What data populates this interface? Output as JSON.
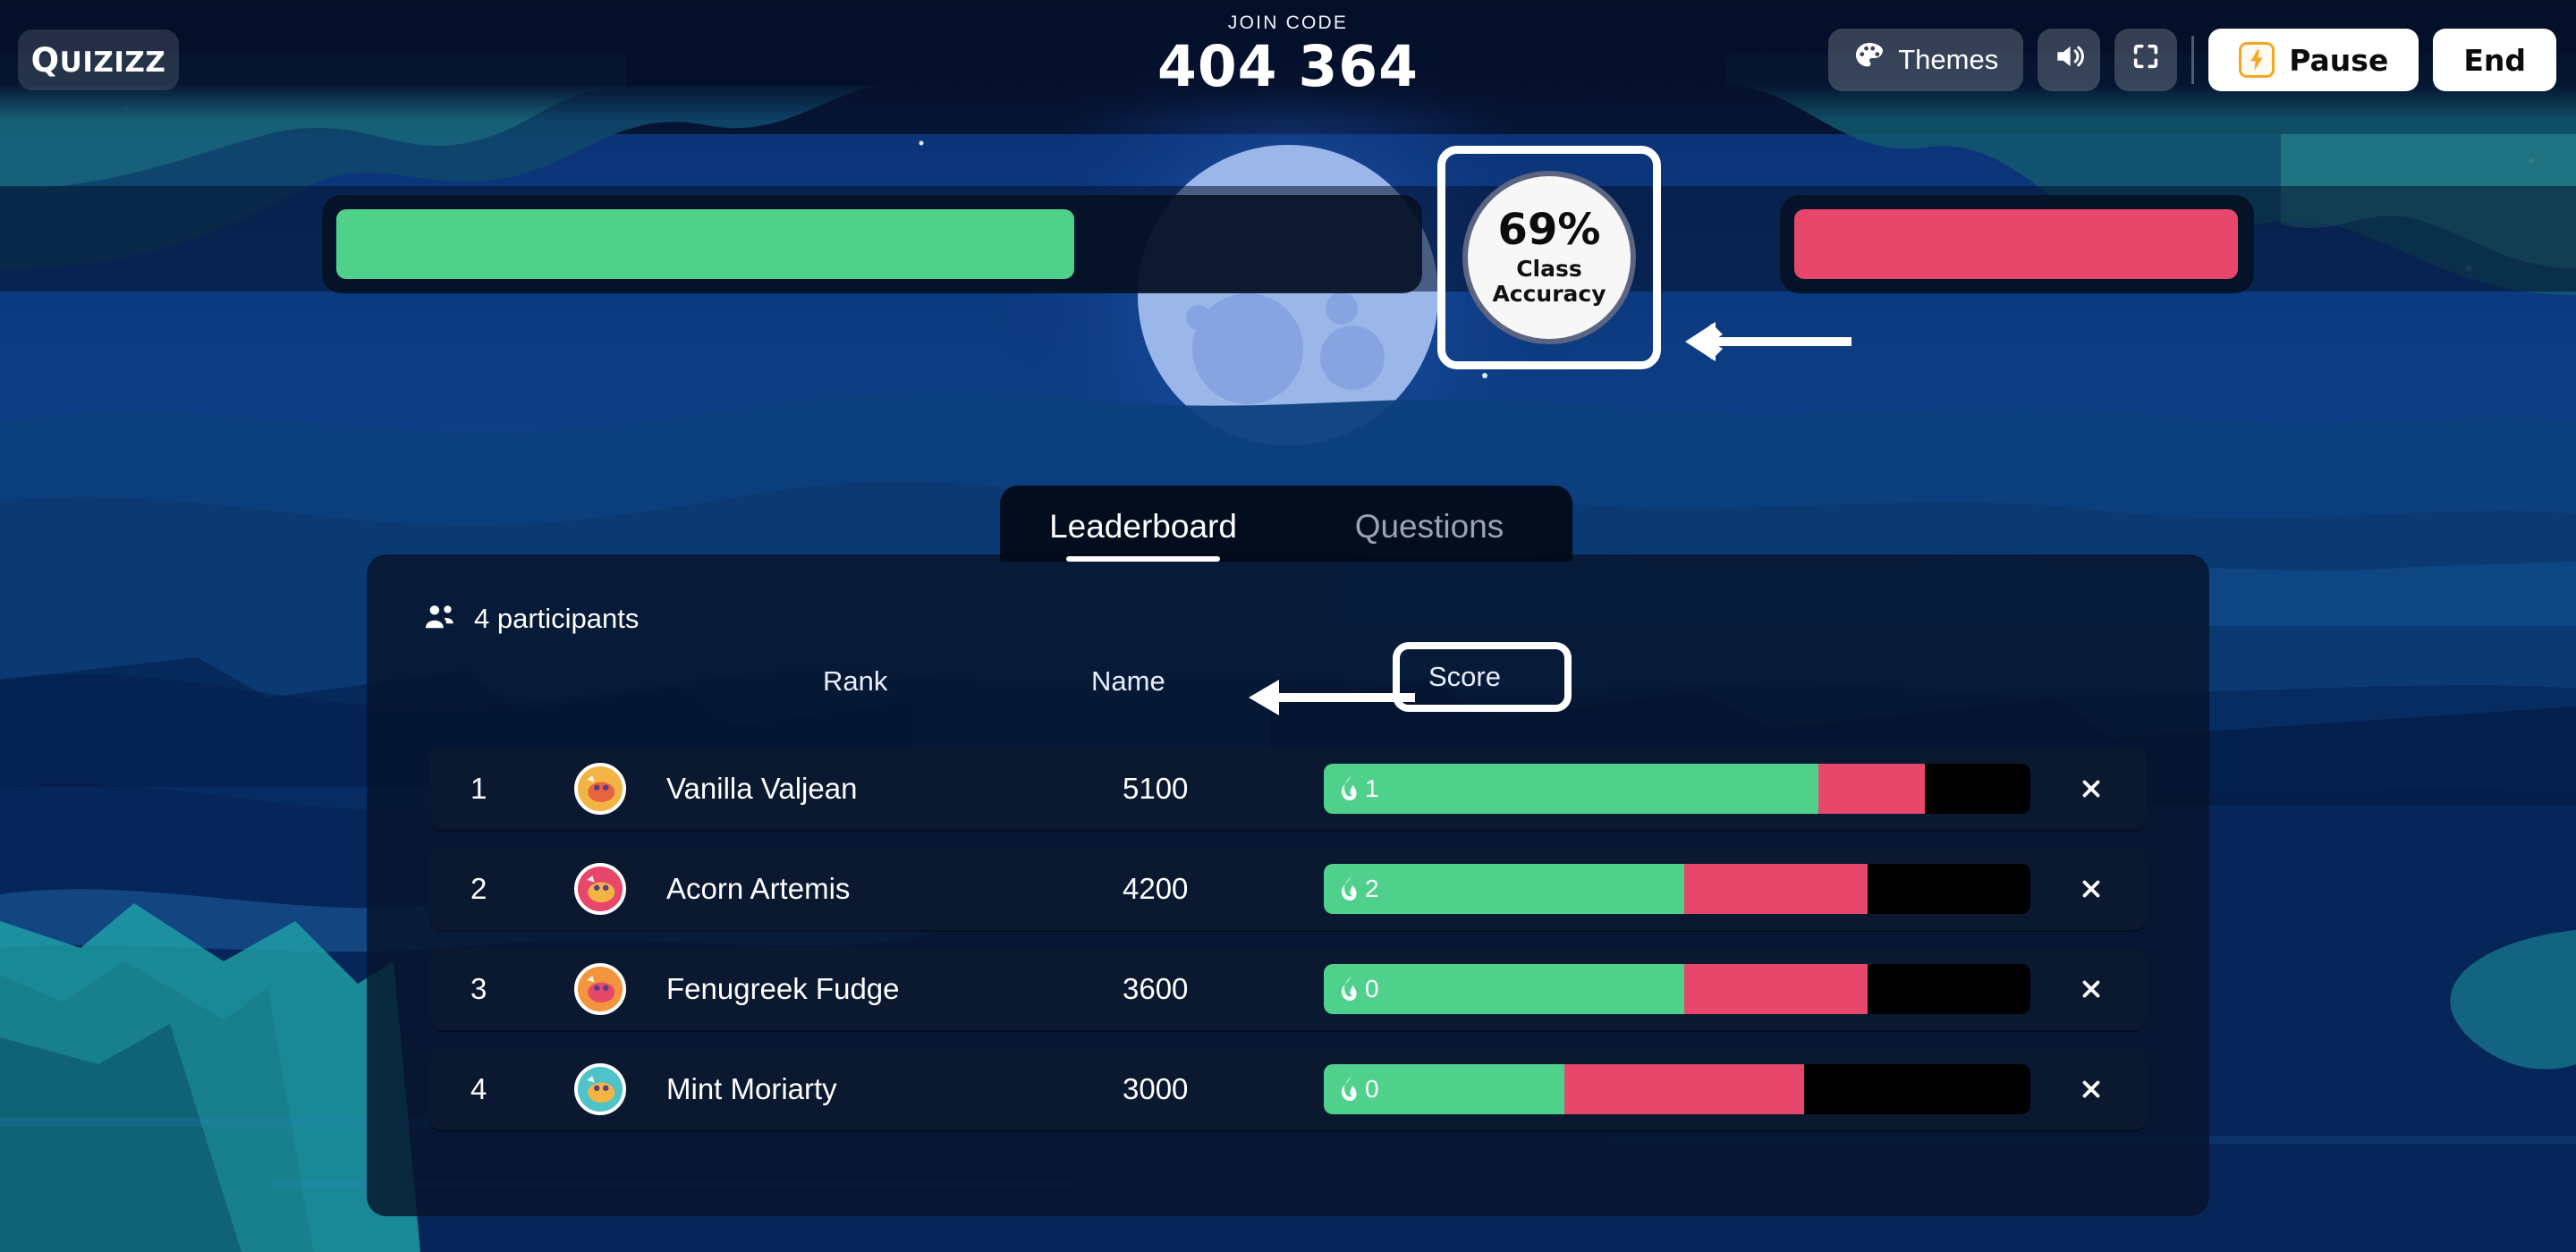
{
  "header": {
    "logo_text": "Quizizz",
    "join_code_label": "JOIN CODE",
    "join_code": "404 364",
    "themes_label": "Themes",
    "themes_icon": "palette-icon",
    "volume_icon": "speaker-icon",
    "fullscreen_icon": "fullscreen-icon",
    "pause_label": "Pause",
    "pause_icon": "lightning-bolt-icon",
    "end_label": "End"
  },
  "class_progress": {
    "correct_percent": 69,
    "incorrect_percent": 100,
    "green_color": "#4fd18b",
    "red_color": "#e8476c",
    "accuracy": {
      "percent_text": "69%",
      "label_line1": "Class",
      "label_line2": "Accuracy",
      "highlighted": true
    }
  },
  "tabs": [
    {
      "label": "Leaderboard",
      "active": true
    },
    {
      "label": "Questions",
      "active": false
    }
  ],
  "leaderboard": {
    "participants_icon": "people-icon",
    "participants_text": "4 participants",
    "columns": {
      "rank": "Rank",
      "name": "Name",
      "score": "Score",
      "score_highlighted": true
    },
    "remove_icon": "close-icon",
    "streak_icon": "flame-icon",
    "rows": [
      {
        "rank": "1",
        "name": "Vanilla Valjean",
        "score": "5100",
        "streak": "1",
        "green_pct": 70,
        "red_pct": 15,
        "avatar_bg": "#f2b544",
        "avatar_fg": "#e8643c"
      },
      {
        "rank": "2",
        "name": "Acorn Artemis",
        "score": "4200",
        "streak": "2",
        "green_pct": 51,
        "red_pct": 26,
        "avatar_bg": "#e8476c",
        "avatar_fg": "#f2b544"
      },
      {
        "rank": "3",
        "name": "Fenugreek Fudge",
        "score": "3600",
        "streak": "0",
        "green_pct": 51,
        "red_pct": 26,
        "avatar_bg": "#f2953c",
        "avatar_fg": "#e8476c"
      },
      {
        "rank": "4",
        "name": "Mint Moriarty",
        "score": "3000",
        "streak": "0",
        "green_pct": 34,
        "red_pct": 34,
        "avatar_bg": "#4fc3c9",
        "avatar_fg": "#f2b544"
      }
    ]
  },
  "annotations": [
    {
      "name": "accuracy-arrow",
      "direction": "left"
    },
    {
      "name": "score-arrow",
      "direction": "left"
    }
  ]
}
